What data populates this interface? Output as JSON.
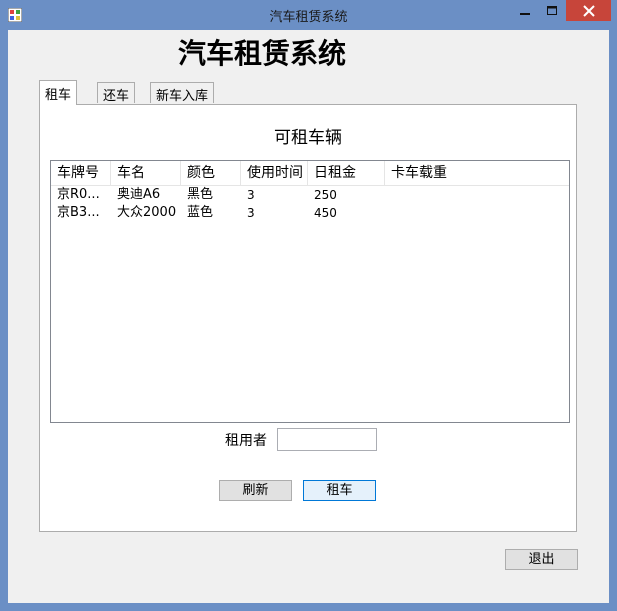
{
  "window": {
    "title": "汽车租赁系统",
    "icons": [
      "app-icon",
      "minimize-icon",
      "maximize-icon",
      "close-icon"
    ]
  },
  "app_title": "汽车租赁系统",
  "tabs": [
    {
      "label": "租车",
      "active": true
    },
    {
      "label": "还车",
      "active": false
    },
    {
      "label": "新车入库",
      "active": false
    }
  ],
  "panel": {
    "heading": "可租车辆",
    "columns": [
      "车牌号",
      "车名",
      "颜色",
      "使用时间",
      "日租金",
      "卡车载重"
    ],
    "rows": [
      [
        "京R0...",
        "奥迪A6",
        "黑色",
        "3",
        "250",
        ""
      ],
      [
        "京B3...",
        "大众2000",
        "蓝色",
        "3",
        "450",
        ""
      ]
    ],
    "renter_label": "租用者",
    "renter_value": "",
    "refresh_label": "刷新",
    "rent_label": "租车"
  },
  "exit_label": "退出",
  "colors": {
    "titlebar": "#6b8fc5",
    "close_button": "#c7453a",
    "client_bg": "#f0f0f0",
    "focus_border": "#0078d7"
  }
}
